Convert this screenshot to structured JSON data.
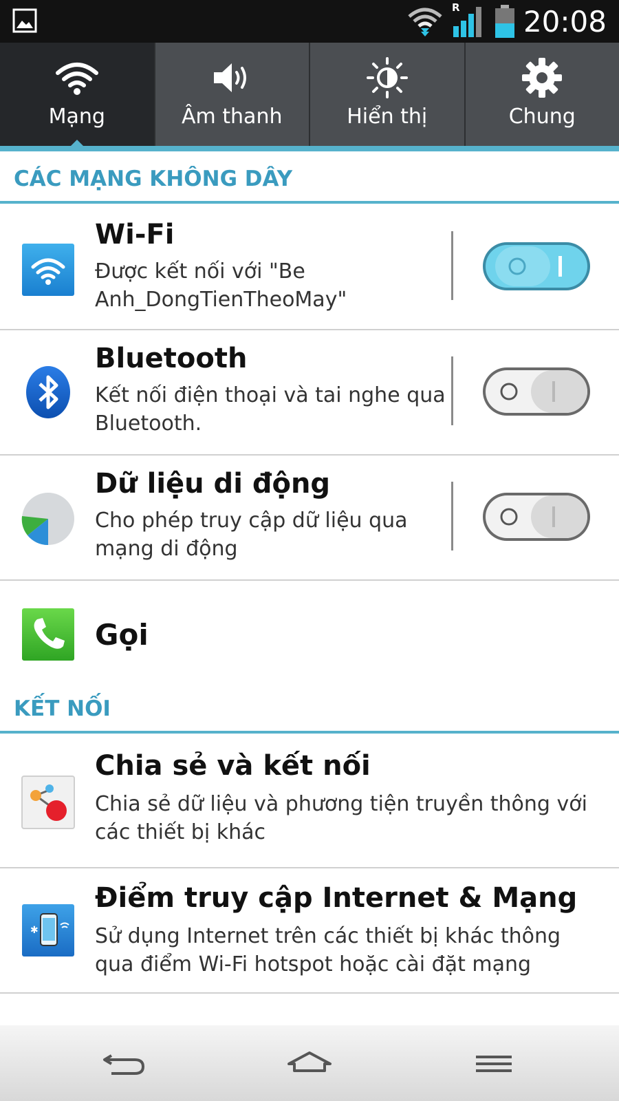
{
  "status_bar": {
    "time": "20:08",
    "roaming_indicator": "R",
    "icons": [
      "gallery-icon",
      "wifi-icon",
      "signal-icon",
      "battery-icon"
    ]
  },
  "tabs": [
    {
      "label": "Mạng",
      "icon": "wifi-icon",
      "active": true
    },
    {
      "label": "Âm thanh",
      "icon": "speaker-icon",
      "active": false
    },
    {
      "label": "Hiển thị",
      "icon": "brightness-icon",
      "active": false
    },
    {
      "label": "Chung",
      "icon": "gear-icon",
      "active": false
    }
  ],
  "sections": {
    "wireless": {
      "header": "CÁC MẠNG KHÔNG DÂY",
      "items": {
        "wifi": {
          "title": "Wi-Fi",
          "desc": "Được kết nối với \"Be Anh_DongTienTheoMay\"",
          "toggle_on": true
        },
        "bluetooth": {
          "title": "Bluetooth",
          "desc": "Kết nối điện thoại và tai nghe qua Bluetooth.",
          "toggle_on": false
        },
        "mobile_data": {
          "title": "Dữ liệu di động",
          "desc": "Cho phép truy cập dữ liệu qua mạng di động",
          "toggle_on": false
        },
        "call": {
          "title": "Gọi"
        }
      }
    },
    "connections": {
      "header": "KẾT NỐI",
      "items": {
        "share": {
          "title": "Chia sẻ và kết nối",
          "desc": "Chia sẻ dữ liệu và phương tiện truyền thông với các thiết bị khác"
        },
        "hotspot": {
          "title": "Điểm truy cập Internet & Mạng",
          "desc": "Sử dụng Internet trên các thiết bị khác thông qua điểm Wi-Fi hotspot hoặc cài đặt mạng"
        }
      }
    }
  },
  "colors": {
    "accent": "#56b2cc",
    "header_text": "#3a9bbf",
    "tab_bg": "#4b4e52",
    "tab_active_bg": "#25272a",
    "toggle_on": "#6fd3ec"
  },
  "nav_bar": [
    "back-icon",
    "home-icon",
    "menu-icon"
  ]
}
